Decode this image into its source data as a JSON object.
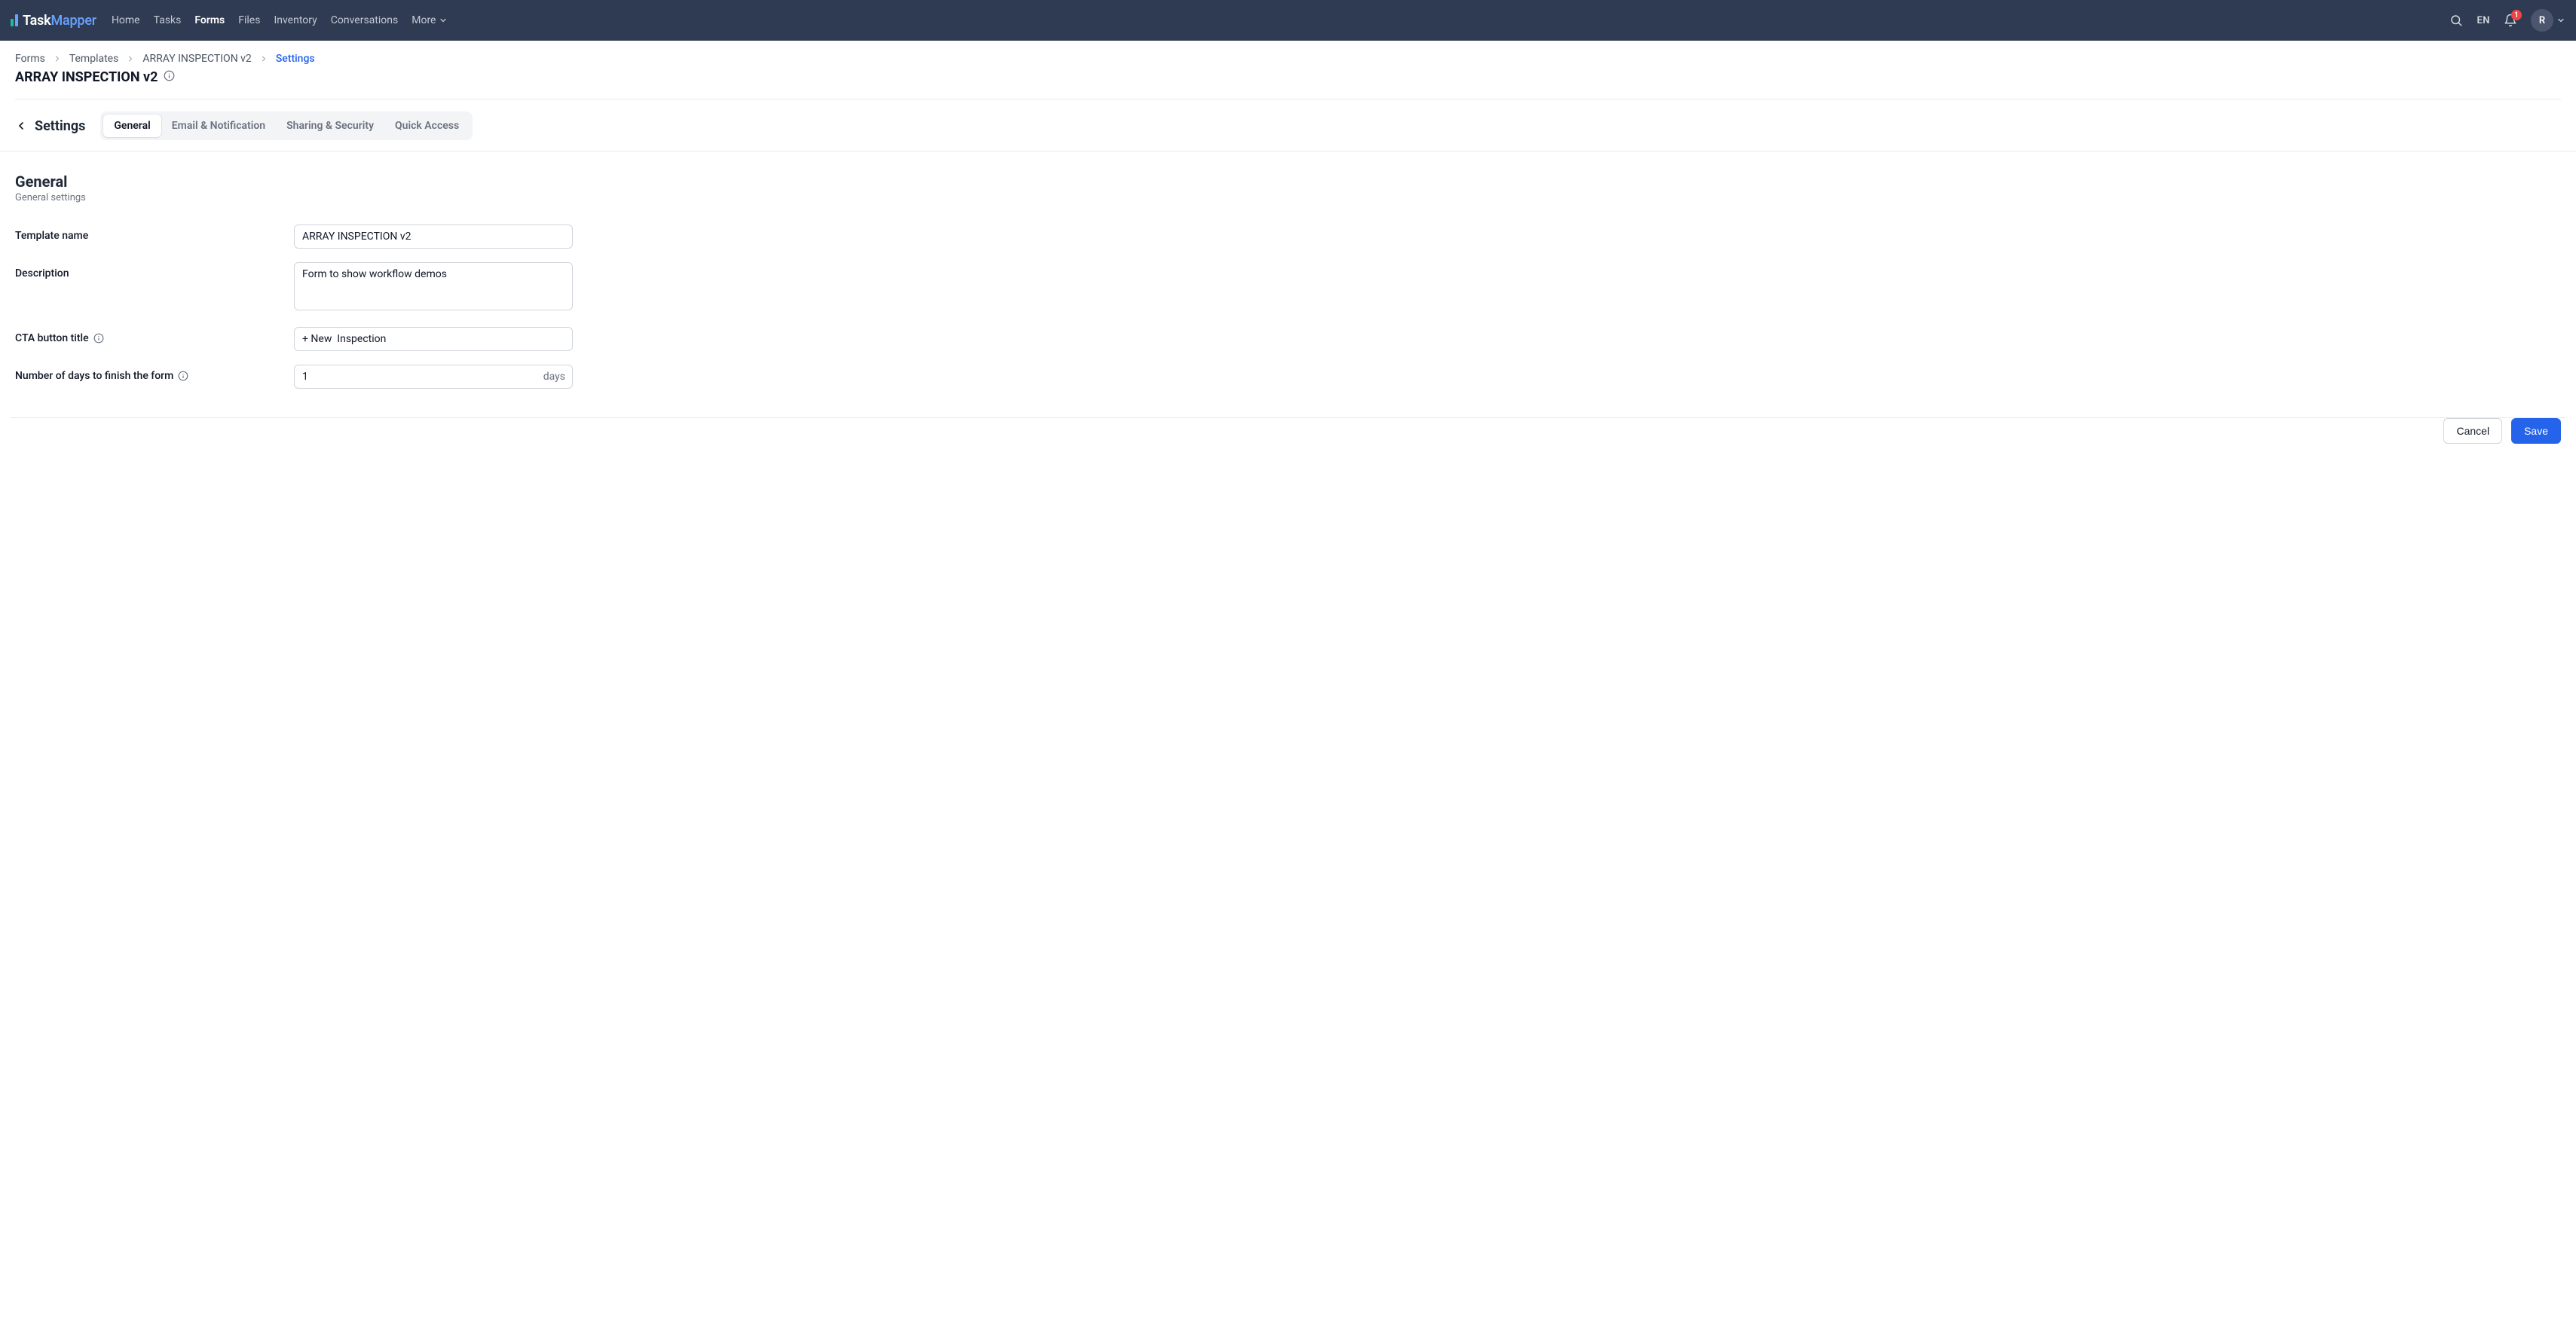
{
  "brand": {
    "task": "Task",
    "mapper": "Mapper"
  },
  "nav": {
    "items": [
      {
        "label": "Home",
        "active": false
      },
      {
        "label": "Tasks",
        "active": false
      },
      {
        "label": "Forms",
        "active": true
      },
      {
        "label": "Files",
        "active": false
      },
      {
        "label": "Inventory",
        "active": false
      },
      {
        "label": "Conversations",
        "active": false
      }
    ],
    "more_label": "More",
    "lang": "EN",
    "notif_count": "1",
    "avatar_initial": "R"
  },
  "breadcrumb": {
    "items": [
      {
        "label": "Forms"
      },
      {
        "label": "Templates"
      },
      {
        "label": "ARRAY INSPECTION v2"
      },
      {
        "label": "Settings",
        "current": true
      }
    ]
  },
  "page": {
    "title": "ARRAY INSPECTION v2"
  },
  "settings_header": {
    "heading": "Settings",
    "tabs": [
      {
        "label": "General",
        "active": true
      },
      {
        "label": "Email & Notification",
        "active": false
      },
      {
        "label": "Sharing & Security",
        "active": false
      },
      {
        "label": "Quick Access",
        "active": false
      }
    ]
  },
  "section": {
    "title": "General",
    "subtitle": "General settings"
  },
  "form": {
    "template_name": {
      "label": "Template name",
      "value": "ARRAY INSPECTION v2"
    },
    "description": {
      "label": "Description",
      "value": "Form to show workflow demos"
    },
    "cta_button_title": {
      "label": "CTA button title",
      "value": "+ New  Inspection"
    },
    "days_to_finish": {
      "label": "Number of days to finish the form",
      "value": "1",
      "suffix": "days"
    }
  },
  "actions": {
    "cancel": "Cancel",
    "save": "Save"
  }
}
